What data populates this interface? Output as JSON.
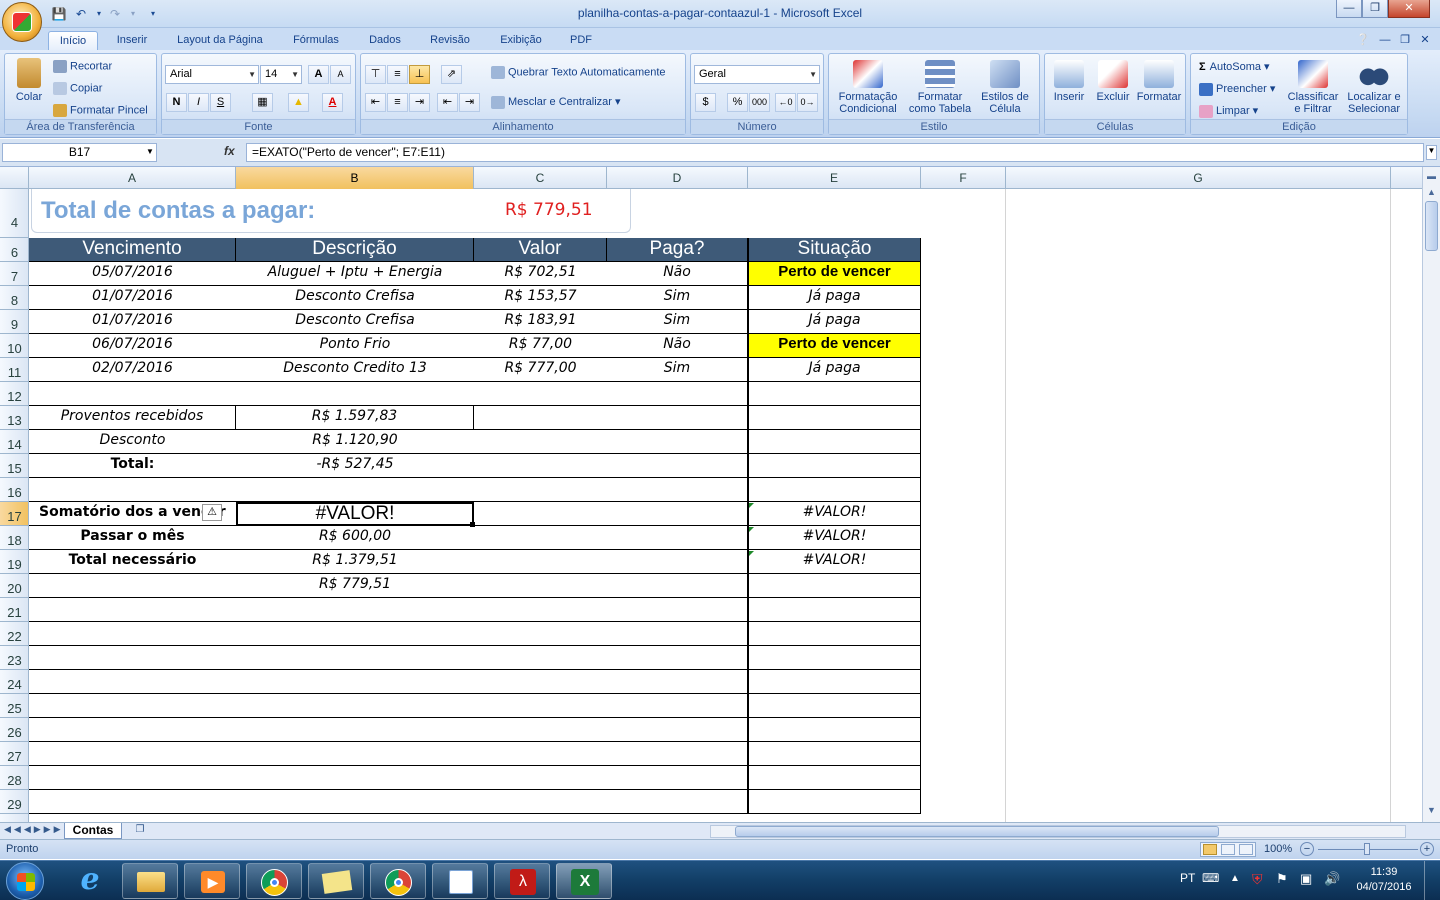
{
  "window": {
    "title": "planilha-contas-a-pagar-contaazul-1 - Microsoft Excel",
    "minimize_icon": "minimize-icon",
    "maximize_icon": "restore-icon",
    "close_icon": "close-icon"
  },
  "ribbon_tabs": [
    "Início",
    "Inserir",
    "Layout da Página",
    "Fórmulas",
    "Dados",
    "Revisão",
    "Exibição",
    "PDF"
  ],
  "ribbon": {
    "clipboard": {
      "paste": "Colar",
      "cut": "Recortar",
      "copy": "Copiar",
      "format_painter": "Formatar Pincel",
      "label": "Área de Transferência"
    },
    "font": {
      "name": "Arial",
      "size": "14",
      "bold": "N",
      "italic": "I",
      "underline": "S",
      "label": "Fonte",
      "grow": "A",
      "shrink": "A",
      "color_letter": "A"
    },
    "alignment": {
      "wrap": "Quebrar Texto Automaticamente",
      "merge": "Mesclar e Centralizar",
      "label": "Alinhamento"
    },
    "number": {
      "format": "Geral",
      "percent": "%",
      "thousands": "000",
      "label": "Número"
    },
    "styles": {
      "conditional": [
        "Formatação",
        "Condicional"
      ],
      "as_table": [
        "Formatar",
        "como Tabela"
      ],
      "cell_styles": [
        "Estilos de",
        "Célula"
      ],
      "label": "Estilo"
    },
    "cells": {
      "insert": "Inserir",
      "delete": "Excluir",
      "format": "Formatar",
      "label": "Células"
    },
    "editing": {
      "autosum": "AutoSoma",
      "fill": "Preencher",
      "clear": "Limpar",
      "sort": [
        "Classificar",
        "e Filtrar"
      ],
      "find": [
        "Localizar e",
        "Selecionar"
      ],
      "label": "Edição"
    }
  },
  "formula_bar": {
    "name_box": "B17",
    "fx": "fx",
    "formula": "=EXATO(\"Perto de vencer\";  E7:E11)"
  },
  "columns": [
    "A",
    "B",
    "C",
    "D",
    "E",
    "F",
    "G"
  ],
  "rows": [
    "4",
    "6",
    "7",
    "8",
    "9",
    "10",
    "11",
    "12",
    "13",
    "14",
    "15",
    "16",
    "17",
    "18",
    "19",
    "20",
    "21",
    "22",
    "23",
    "24",
    "25",
    "26",
    "27",
    "28",
    "29"
  ],
  "summary": {
    "label": "Total de contas a pagar:",
    "value": "R$ 779,51"
  },
  "table": {
    "headers": [
      "Vencimento",
      "Descrição",
      "Valor",
      "Paga?",
      "Situação"
    ],
    "rows": [
      [
        "05/07/2016",
        "Aluguel + Iptu + Energia",
        "R$ 702,51",
        "Não",
        "Perto de vencer"
      ],
      [
        "01/07/2016",
        "Desconto Crefisa",
        "R$ 153,57",
        "Sim",
        "Já paga"
      ],
      [
        "01/07/2016",
        "Desconto Crefisa",
        "R$ 183,91",
        "Sim",
        "Já paga"
      ],
      [
        "06/07/2016",
        "Ponto Frio",
        "R$ 77,00",
        "Não",
        "Perto de vencer"
      ],
      [
        "02/07/2016",
        "Desconto Credito 13",
        "R$ 777,00",
        "Sim",
        "Já paga"
      ]
    ]
  },
  "calc": {
    "proventos_label": "Proventos recebidos",
    "proventos_value": "R$ 1.597,83",
    "desconto_label": "Desconto",
    "desconto_value": "R$ 1.120,90",
    "total_label": "Total:",
    "total_value": "-R$ 527,45",
    "somatorio_label": "Somatório dos a vencer",
    "somatorio_value": "#VALOR!",
    "somatorio_e": "#VALOR!",
    "passar_label": "Passar o mês",
    "passar_value": "R$ 600,00",
    "passar_e": "#VALOR!",
    "necessario_label": "Total necessário",
    "necessario_value": "R$ 1.379,51",
    "necessario_e": "#VALOR!",
    "row20_value": "R$ 779,51"
  },
  "sheet_tab": "Contas",
  "status": {
    "ready": "Pronto",
    "zoom": "100%"
  },
  "taskbar": {
    "lang": "PT",
    "time": "11:39",
    "date": "04/07/2016"
  }
}
